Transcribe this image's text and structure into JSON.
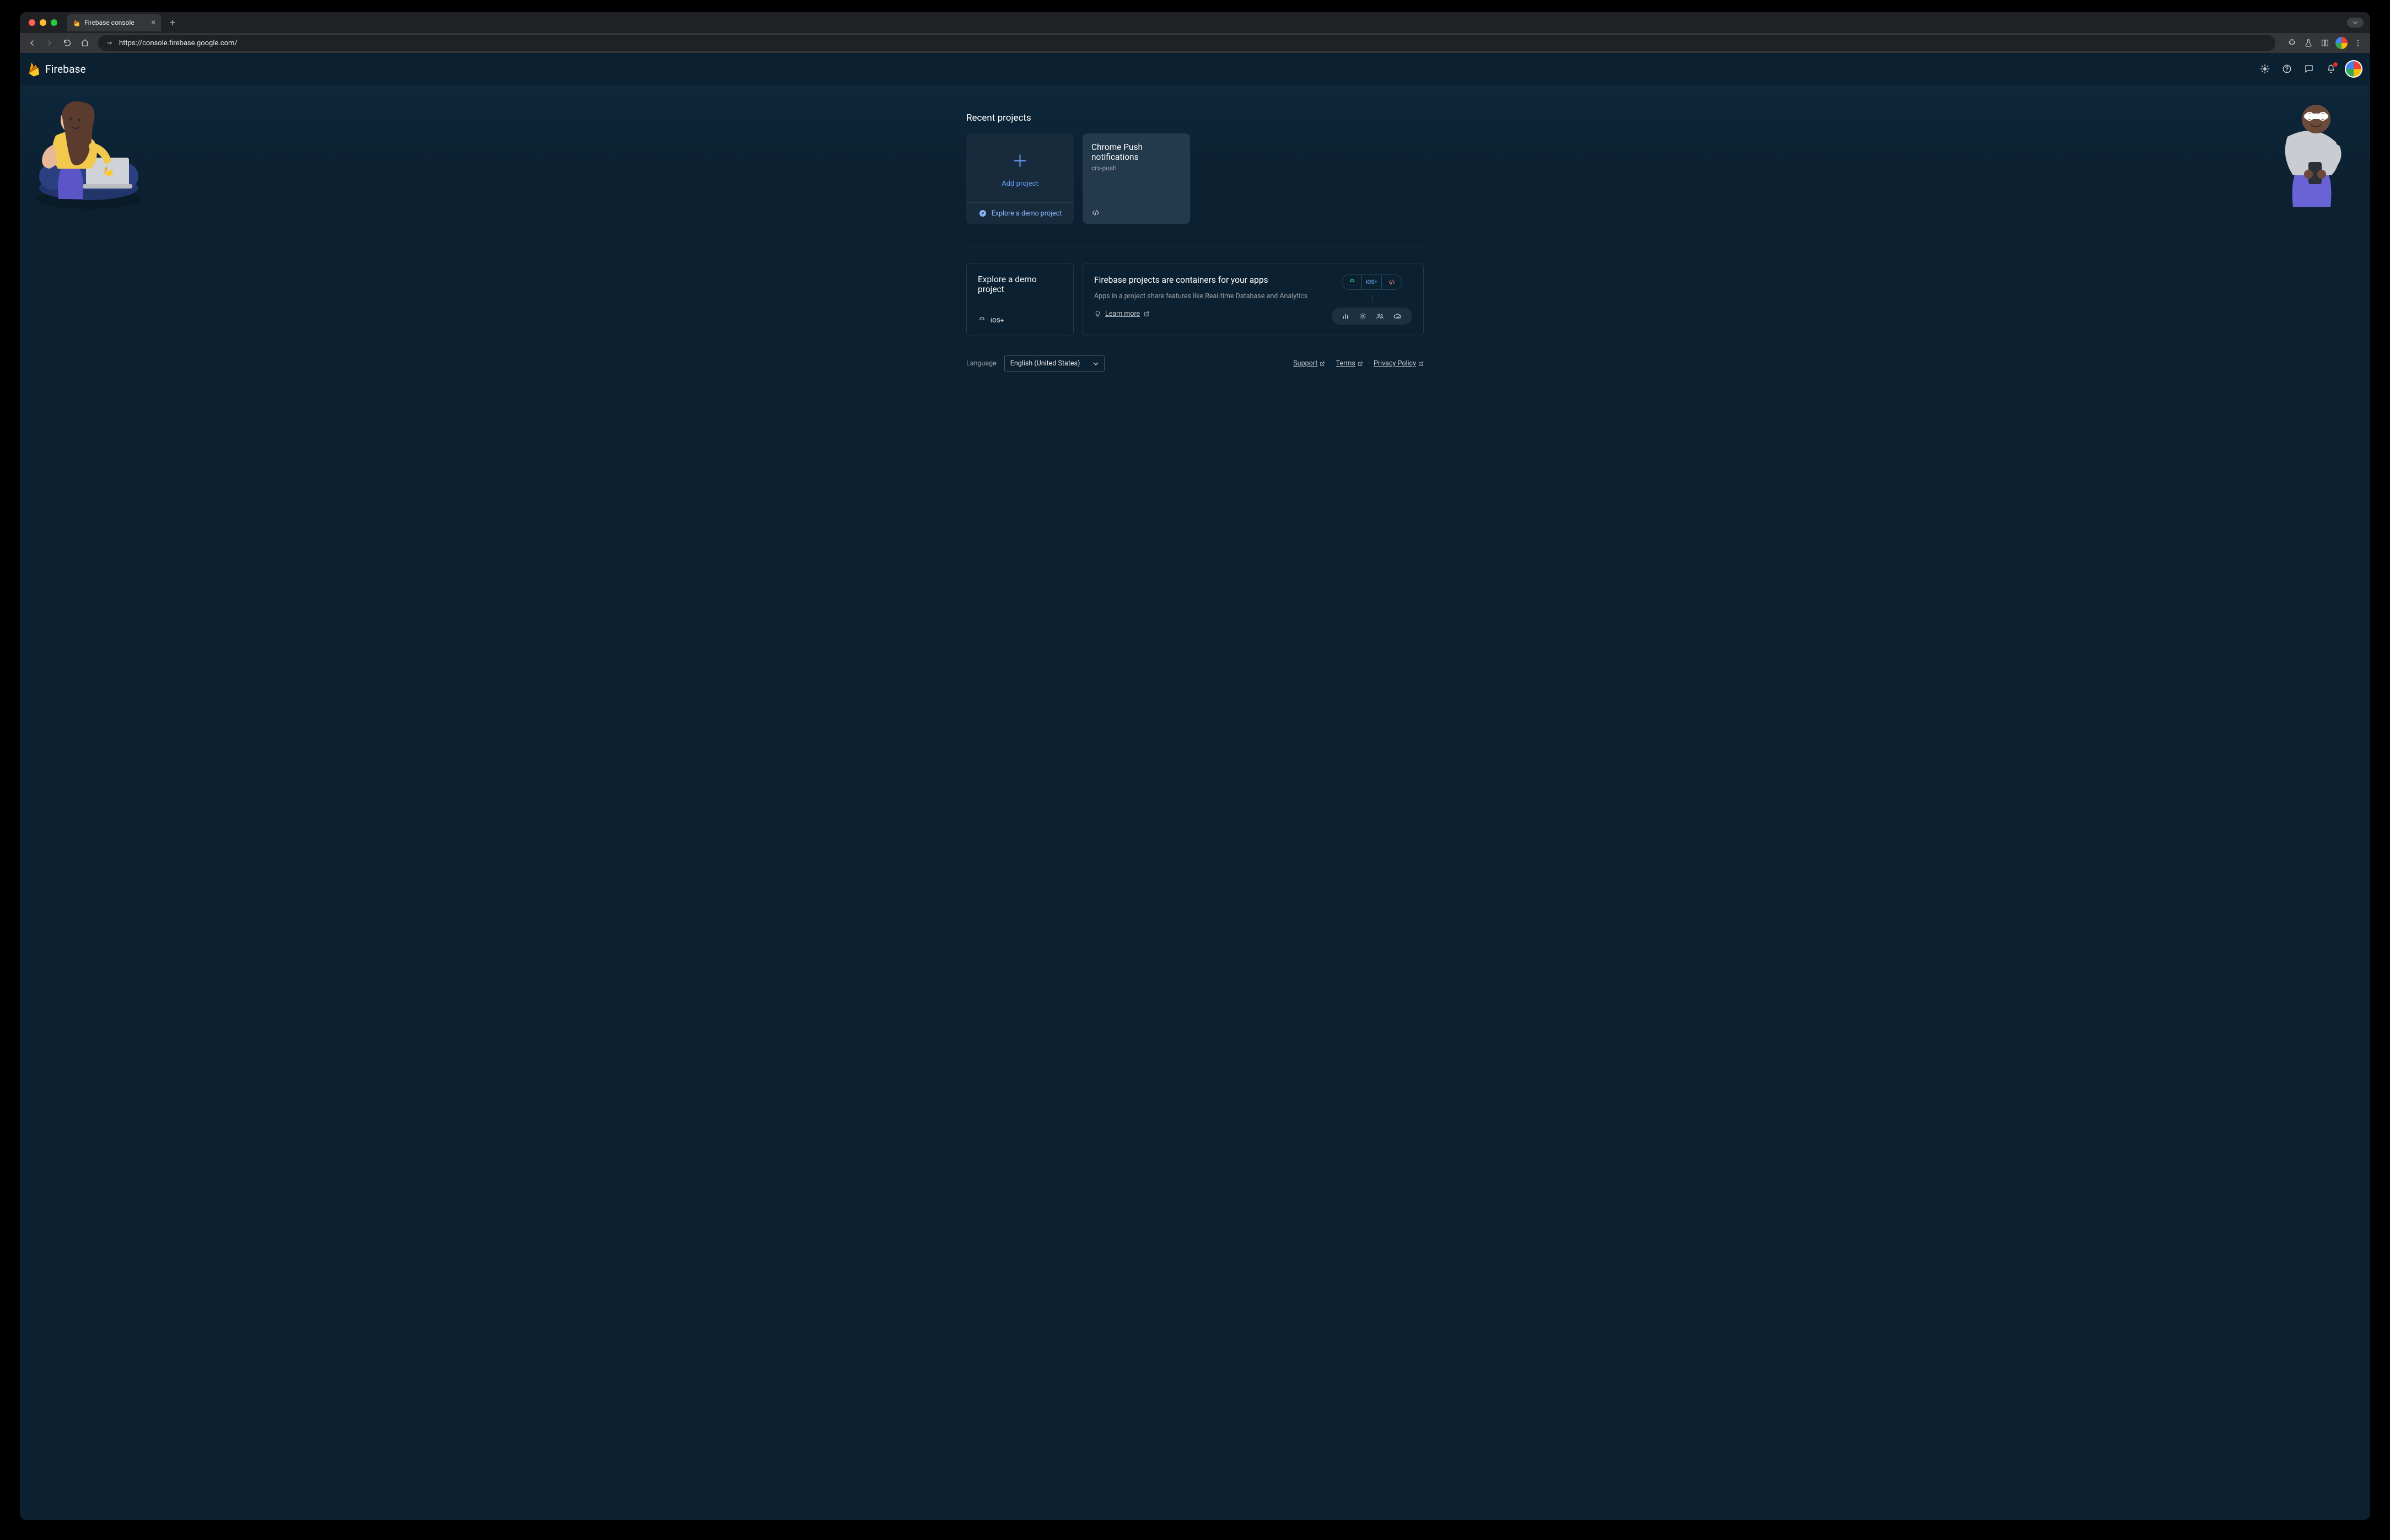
{
  "browser": {
    "tab_title": "Firebase console",
    "url": "https://console.firebase.google.com/"
  },
  "header": {
    "brand": "Firebase"
  },
  "recent": {
    "title": "Recent projects",
    "add_label": "Add project",
    "explore_demo": "Explore a demo project",
    "projects": [
      {
        "name": "Chrome Push notifications",
        "id": "crx-push",
        "platforms": [
          "web"
        ]
      }
    ]
  },
  "lower": {
    "demo_title": "Explore a demo project",
    "containers_title": "Firebase projects are containers for your apps",
    "containers_desc": "Apps in a project share features like Real-time Database and Analytics",
    "learn_more": "Learn more"
  },
  "footer": {
    "language_label": "Language",
    "language_value": "English (United States)",
    "links": {
      "support": "Support",
      "terms": "Terms",
      "privacy": "Privacy Policy"
    }
  }
}
